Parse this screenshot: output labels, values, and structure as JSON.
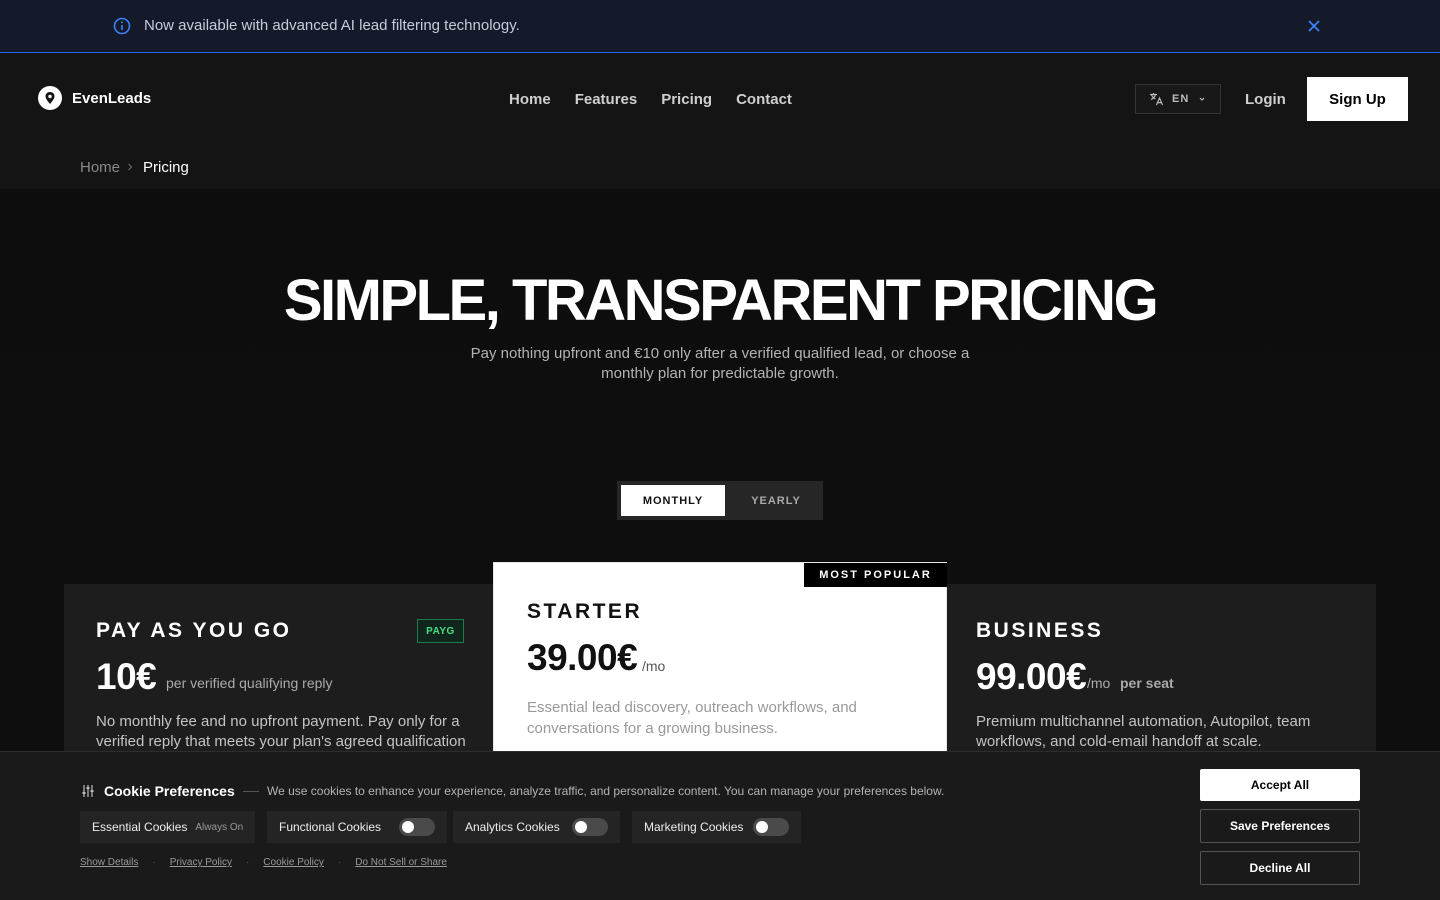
{
  "announcement": {
    "text": "Now available with advanced AI lead filtering technology."
  },
  "header": {
    "brand": "EvenLeads",
    "nav": [
      "Home",
      "Features",
      "Pricing",
      "Contact"
    ],
    "language": "EN",
    "login": "Login",
    "signup": "Sign Up"
  },
  "breadcrumb": {
    "home": "Home",
    "current": "Pricing"
  },
  "hero": {
    "title": "SIMPLE, TRANSPARENT PRICING",
    "subtitle": "Pay nothing upfront and €10 only after a verified qualified lead, or choose a monthly plan for predictable growth."
  },
  "billing_toggle": {
    "monthly": "MONTHLY",
    "yearly": "YEARLY",
    "selected": "MONTHLY"
  },
  "plans": [
    {
      "name": "PAY AS YOU GO",
      "badge": "PAYG",
      "price": "10€",
      "unit": "per verified qualifying reply",
      "description": "No monthly fee and no upfront payment. Pay only for a verified reply that meets your plan's agreed qualification"
    },
    {
      "name": "STARTER",
      "badge": "MOST POPULAR",
      "price": "39.00€",
      "unit": "/mo",
      "description": "Essential lead discovery, outreach workflows, and conversations for a growing business."
    },
    {
      "name": "BUSINESS",
      "price": "99.00€",
      "unit": "/mo",
      "extra": "per seat",
      "description": "Premium multichannel automation, Autopilot, team workflows, and cold-email handoff at scale."
    }
  ],
  "cookie": {
    "title": "Cookie Preferences",
    "description": "We use cookies to enhance your experience, analyze traffic, and personalize content. You can manage your preferences below.",
    "categories": [
      {
        "label": "Essential Cookies",
        "note": "Always On"
      },
      {
        "label": "Functional Cookies",
        "enabled": false
      },
      {
        "label": "Analytics Cookies",
        "enabled": false
      },
      {
        "label": "Marketing Cookies",
        "enabled": false
      }
    ],
    "links": [
      "Show Details",
      "Privacy Policy",
      "Cookie Policy",
      "Do Not Sell or Share"
    ],
    "accept": "Accept All",
    "save": "Save Preferences",
    "decline": "Decline All"
  },
  "colors": {
    "accent_blue": "#2563eb",
    "payg_green": "#4ade80",
    "background": "#121212"
  }
}
